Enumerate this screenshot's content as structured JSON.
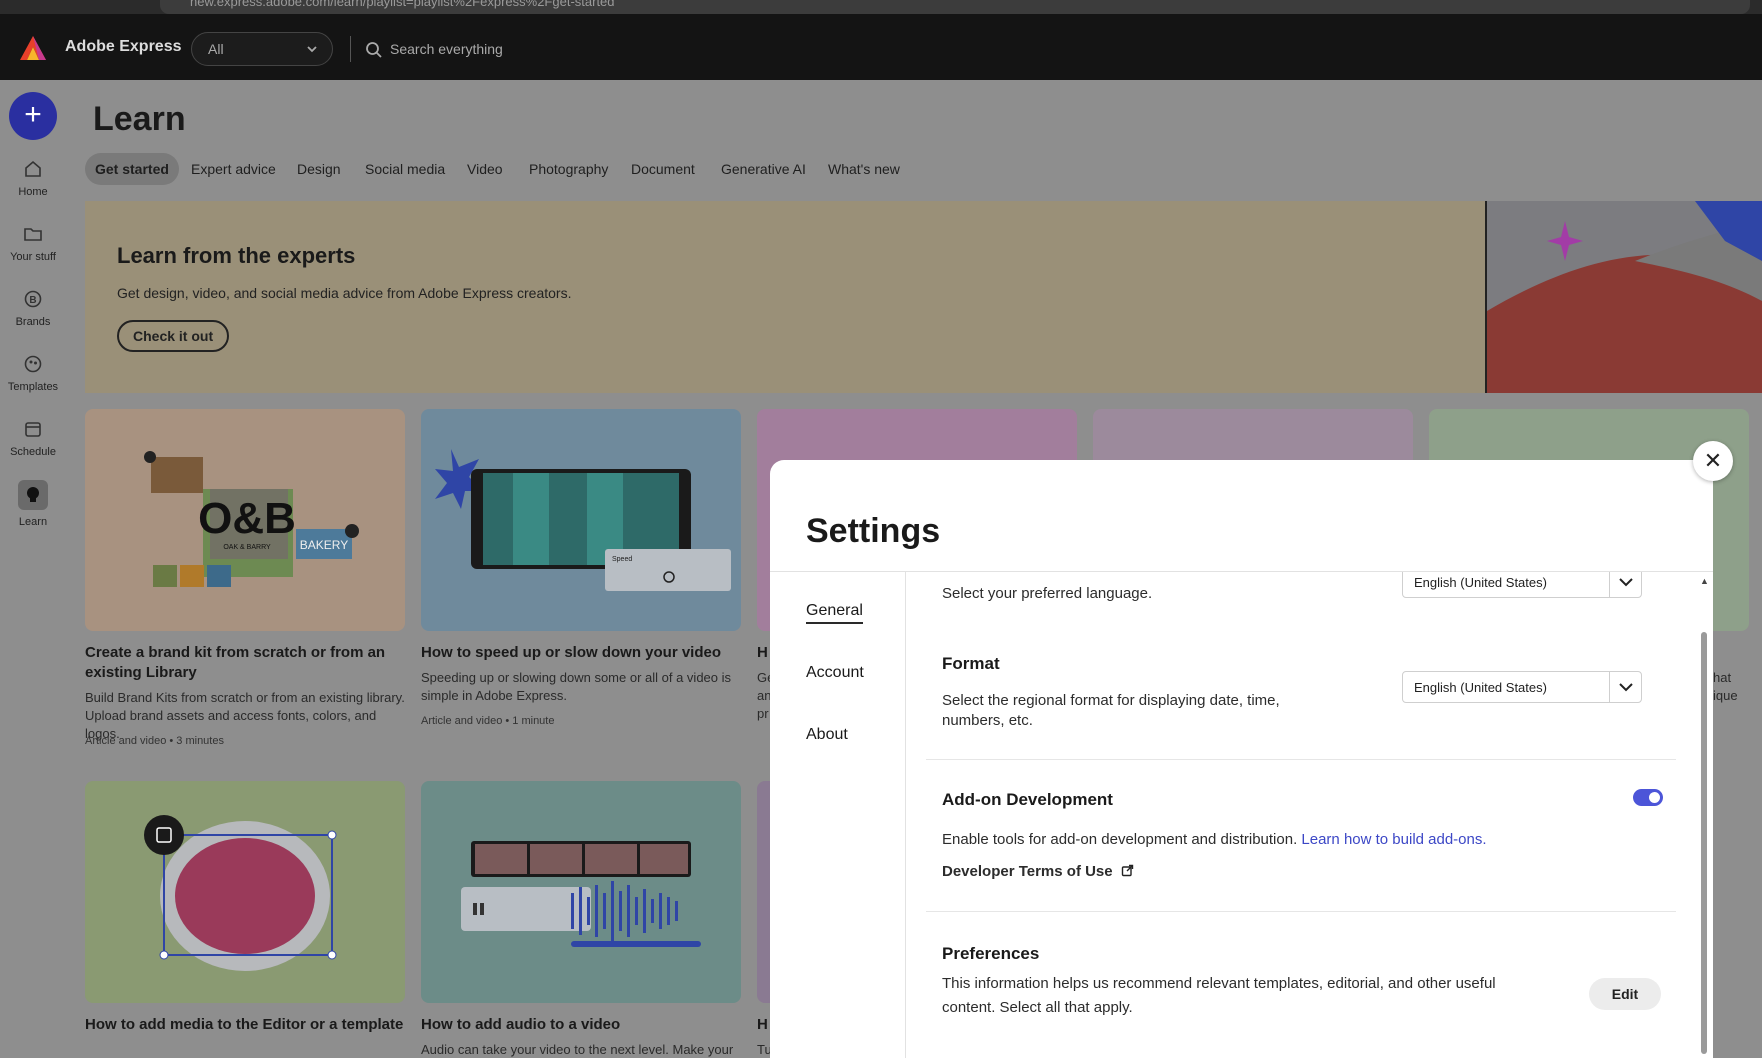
{
  "browser": {
    "url": "new.express.adobe.com/learn/playlist=playlist%2Fexpress%2Fget-started"
  },
  "header": {
    "brand": "Adobe Express",
    "filter_value": "All",
    "search_placeholder": "Search everything"
  },
  "sidebar": {
    "items": [
      {
        "label": "Home",
        "icon": "home-icon"
      },
      {
        "label": "Your stuff",
        "icon": "folder-icon"
      },
      {
        "label": "Brands",
        "icon": "brand-icon"
      },
      {
        "label": "Templates",
        "icon": "templates-icon"
      },
      {
        "label": "Schedule",
        "icon": "calendar-icon"
      },
      {
        "label": "Learn",
        "icon": "lightbulb-icon"
      }
    ]
  },
  "page": {
    "title": "Learn"
  },
  "tabs": [
    "Get started",
    "Expert advice",
    "Design",
    "Social media",
    "Video",
    "Photography",
    "Document",
    "Generative AI",
    "What's new"
  ],
  "banner": {
    "title": "Learn from the experts",
    "subtitle": "Get design, video, and social media advice from Adobe Express creators.",
    "button": "Check it out"
  },
  "cards": [
    {
      "title": "Create a brand kit from scratch or from an existing Library",
      "desc": "Build Brand Kits from scratch or from an existing library. Upload brand assets and access fonts, colors, and logos.",
      "meta": "Article and video • 3 minutes",
      "thumb_text": "O&B",
      "thumb_sub": "OAK & BARRY",
      "thumb_tag": "BAKERY"
    },
    {
      "title": "How to speed up or slow down your video",
      "desc": "Speeding up or slowing down some or all of a video is simple in Adobe Express.",
      "meta": "Article and video • 1 minute",
      "thumb_tag": "Speed"
    },
    {
      "title": "H",
      "desc": "Ge an pr",
      "meta": "Art"
    },
    {
      "title": "",
      "desc": ""
    },
    {
      "title": "",
      "desc": "hat ique"
    },
    {
      "title": "How to add media to the Editor or a template"
    },
    {
      "title": "How to add audio to a video",
      "desc": "Audio can take your video to the next level. Make your"
    },
    {
      "title": "H",
      "desc": "Tu"
    }
  ],
  "settings": {
    "title": "Settings",
    "nav": [
      "General",
      "Account",
      "About"
    ],
    "language_desc": "Select your preferred language.",
    "language_value": "English (United States)",
    "format_title": "Format",
    "format_desc": "Select the regional format for displaying date, time, numbers, etc.",
    "format_value": "English (United States)",
    "addon_title": "Add-on Development",
    "addon_desc": "Enable tools for add-on development and distribution.",
    "addon_link": "Learn how to build add-ons.",
    "terms_link": "Developer Terms of Use",
    "addon_enabled": true,
    "prefs_title": "Preferences",
    "prefs_desc": "This information helps us recommend relevant templates, editorial, and other useful content. Select all that apply.",
    "prefs_button": "Edit"
  },
  "colors": {
    "accent": "#4c55d8",
    "link": "#3c47c6",
    "create": "#2a2fa0"
  }
}
